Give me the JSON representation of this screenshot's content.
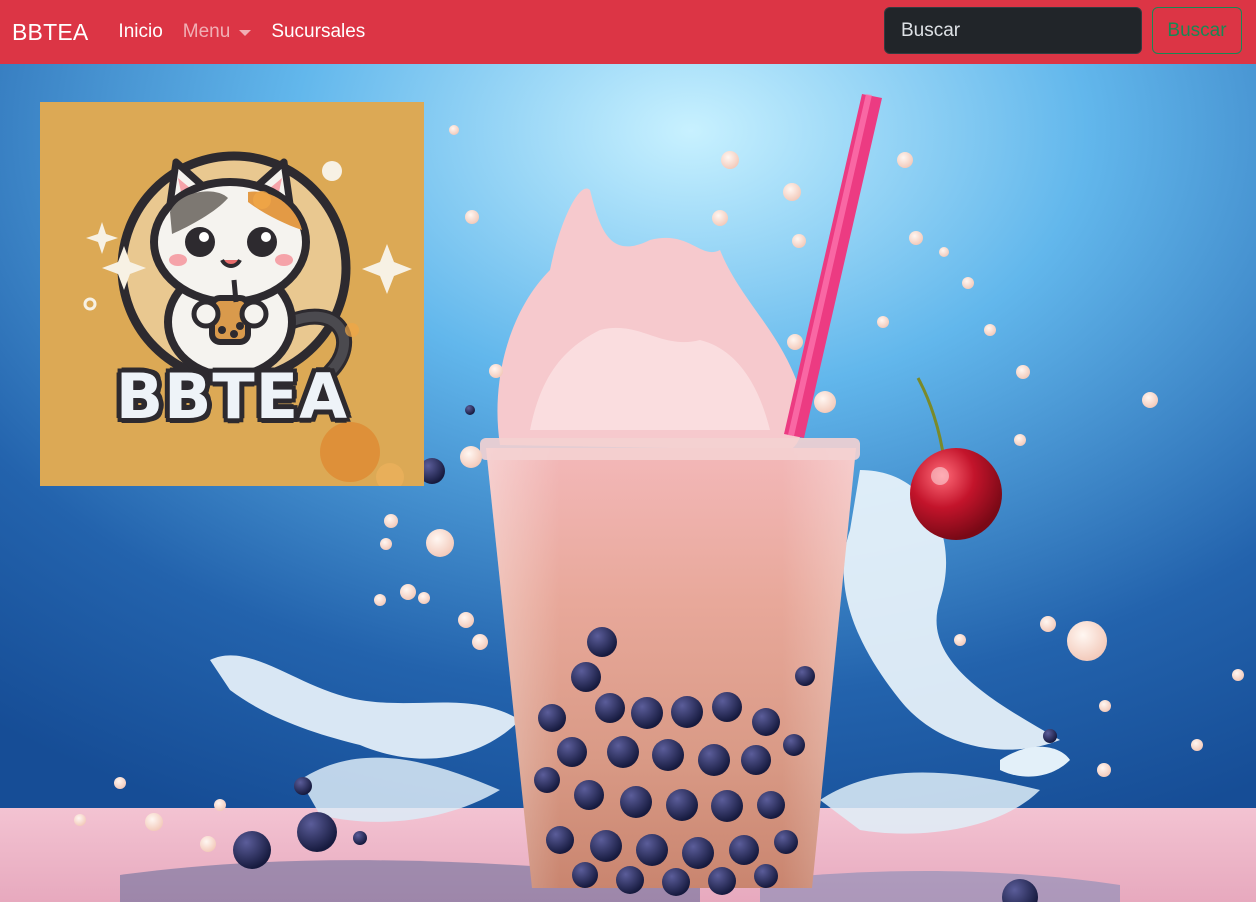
{
  "navbar": {
    "brand": "BBTEA",
    "links": [
      {
        "label": "Inicio"
      },
      {
        "label": "Menu"
      },
      {
        "label": "Sucursales"
      }
    ],
    "search": {
      "placeholder": "Buscar",
      "button_label": "Buscar"
    }
  },
  "logo": {
    "text": "BBTEA"
  },
  "colors": {
    "navbar": "#dc3545",
    "search_button": "#198754",
    "search_input": "#212529"
  }
}
